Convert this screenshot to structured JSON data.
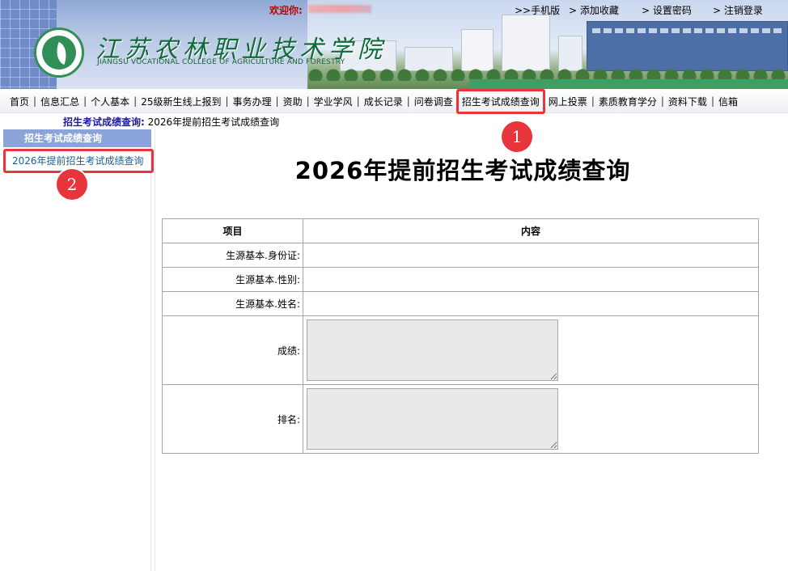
{
  "header": {
    "welcome_label": "欢迎你:",
    "school_name_cn": "江苏农林职业技术学院",
    "school_name_en": "JIANGSU VOCATIONAL COLLEGE OF AGRICULTURE AND FORESTRY",
    "top_links": [
      {
        "label": ">>手机版"
      },
      {
        "label": "> 添加收藏"
      },
      {
        "label": "> 设置密码"
      },
      {
        "label": "> 注销登录"
      }
    ]
  },
  "nav": {
    "items": [
      {
        "label": "首页"
      },
      {
        "label": "信息汇总"
      },
      {
        "label": "个人基本"
      },
      {
        "label": "25级新生线上报到"
      },
      {
        "label": "事务办理"
      },
      {
        "label": "资助"
      },
      {
        "label": "学业学风"
      },
      {
        "label": "成长记录"
      },
      {
        "label": "问卷调查"
      },
      {
        "label": "招生考试成绩查询"
      },
      {
        "label": "网上投票"
      },
      {
        "label": "素质教育学分"
      },
      {
        "label": "资料下载"
      },
      {
        "label": "信箱"
      }
    ],
    "separator": "|"
  },
  "annotations": {
    "callout_1": "1",
    "callout_2": "2",
    "highlight_color": "#e8353b"
  },
  "breadcrumb": {
    "section": "招生考试成绩查询:",
    "current": "2026年提前招生考试成绩查询"
  },
  "sidebar": {
    "heading": "招生考试成绩查询",
    "items": [
      {
        "label": "2026年提前招生考试成绩查询"
      }
    ]
  },
  "main": {
    "title": "2026年提前招生考试成绩查询",
    "table": {
      "headers": [
        "项目",
        "内容"
      ],
      "rows": [
        {
          "label": "生源基本.身份证:",
          "value": ""
        },
        {
          "label": "生源基本.性别:",
          "value": ""
        },
        {
          "label": "生源基本.姓名:",
          "value": ""
        },
        {
          "label": "成绩:",
          "value": ""
        },
        {
          "label": "排名:",
          "value": ""
        }
      ]
    }
  },
  "colors": {
    "sidebar_heading_bg": "#8aa3d8",
    "welcome_text": "#c00000",
    "breadcrumb_title": "#1a1aa6"
  }
}
